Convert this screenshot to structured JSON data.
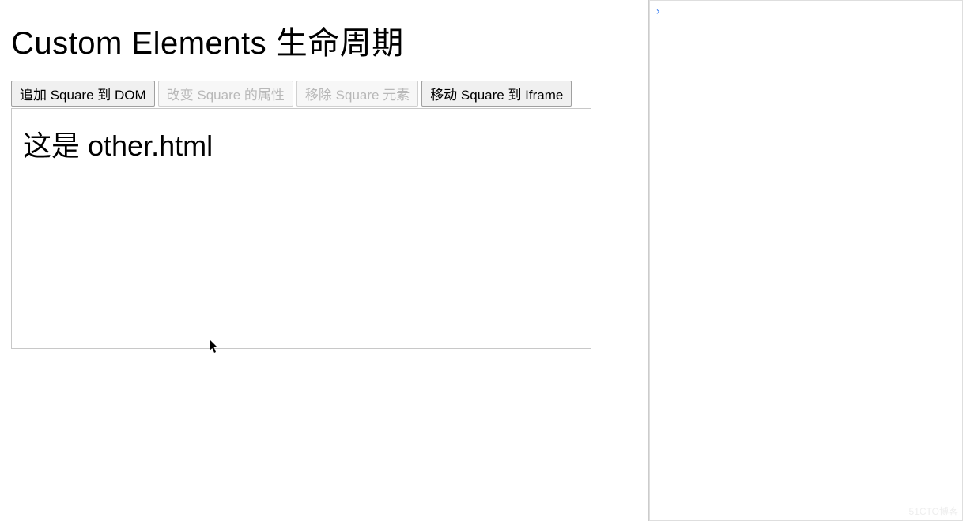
{
  "page": {
    "title": "Custom Elements 生命周期"
  },
  "buttons": {
    "add": {
      "label": "追加 Square 到 DOM",
      "disabled": false
    },
    "change": {
      "label": "改变 Square 的属性",
      "disabled": true
    },
    "remove": {
      "label": "移除 Square 元素",
      "disabled": true
    },
    "move": {
      "label": "移动 Square 到 Iframe",
      "disabled": false
    }
  },
  "iframe": {
    "title": "这是 other.html"
  },
  "devtools": {
    "prompt_glyph": "›"
  },
  "watermark": "51CTO博客"
}
